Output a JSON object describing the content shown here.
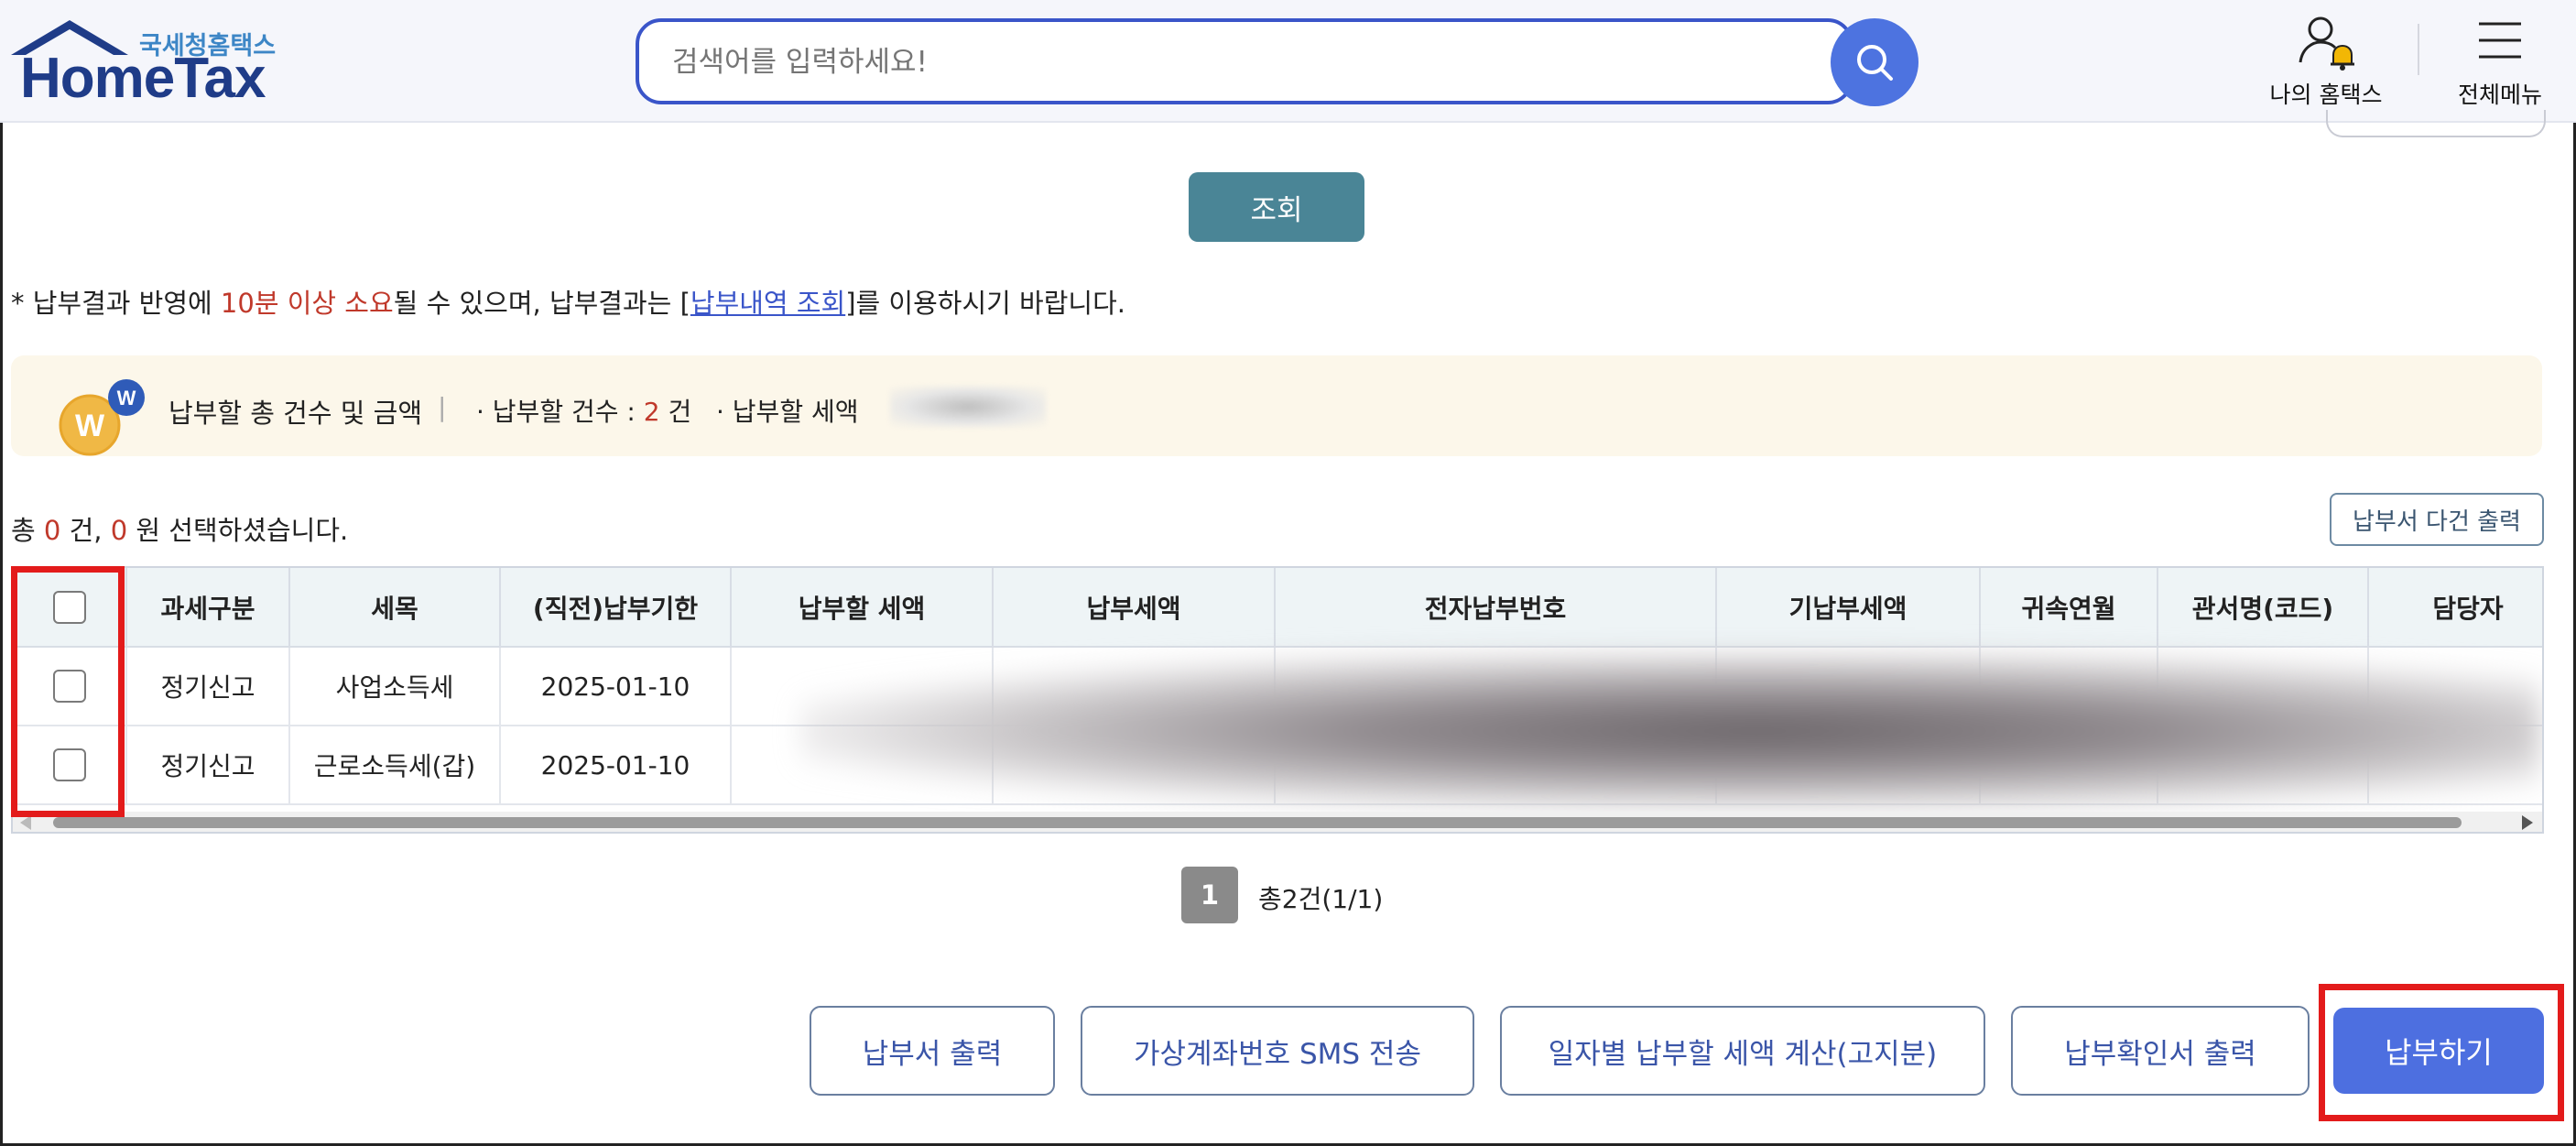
{
  "header": {
    "logo_sub": "국세청홈택스",
    "logo_main": "HomeTax",
    "search_placeholder": "검색어를 입력하세요!",
    "my_home_label": "나의 홈택스",
    "all_menu_label": "전체메뉴"
  },
  "query_label": "조회",
  "notice": {
    "prefix": "* 납부결과 반영에 ",
    "highlight": "10분 이상 소요",
    "middle": "될 수 있으며, 납부결과는 [",
    "link": "납부내역 조회",
    "suffix": "]를 이용하시기 바랍니다."
  },
  "summary": {
    "title": "납부할 총 건수 및 금액",
    "separator": "|",
    "count_label": "· 납부할 건수 : ",
    "count_value": "2",
    "count_unit": " 건",
    "tax_label": "· 납부할 세액"
  },
  "selection": {
    "prefix": "총 ",
    "count": "0",
    "mid": " 건, ",
    "amount": "0",
    "suffix": " 원 선택하셨습니다."
  },
  "multi_print_label": "납부서 다건 출력",
  "table": {
    "headers": [
      "과세구분",
      "세목",
      "(직전)납부기한",
      "납부할 세액",
      "납부세액",
      "전자납부번호",
      "기납부세액",
      "귀속연월",
      "관서명(코드)",
      "담당자"
    ],
    "rows": [
      {
        "type": "정기신고",
        "item": "사업소득세",
        "deadline": "2025-01-10"
      },
      {
        "type": "정기신고",
        "item": "근로소득세(갑)",
        "deadline": "2025-01-10"
      }
    ]
  },
  "pagination": {
    "current": "1",
    "total": "총2건(1/1)"
  },
  "buttons": {
    "print": "납부서 출력",
    "sms": "가상계좌번호 SMS 전송",
    "calc": "일자별 납부할 세액 계산(고지분)",
    "confirm_print": "납부확인서 출력",
    "pay": "납부하기"
  },
  "colors": {
    "accent": "#4d6fe0",
    "query_button": "#4a8596",
    "highlight_red": "#c0392b",
    "annotation_red": "#e31b1b"
  },
  "icons": [
    "house-roof-icon",
    "search-icon",
    "user-bell-icon",
    "hamburger-menu-icon",
    "coin-badge-icon"
  ]
}
